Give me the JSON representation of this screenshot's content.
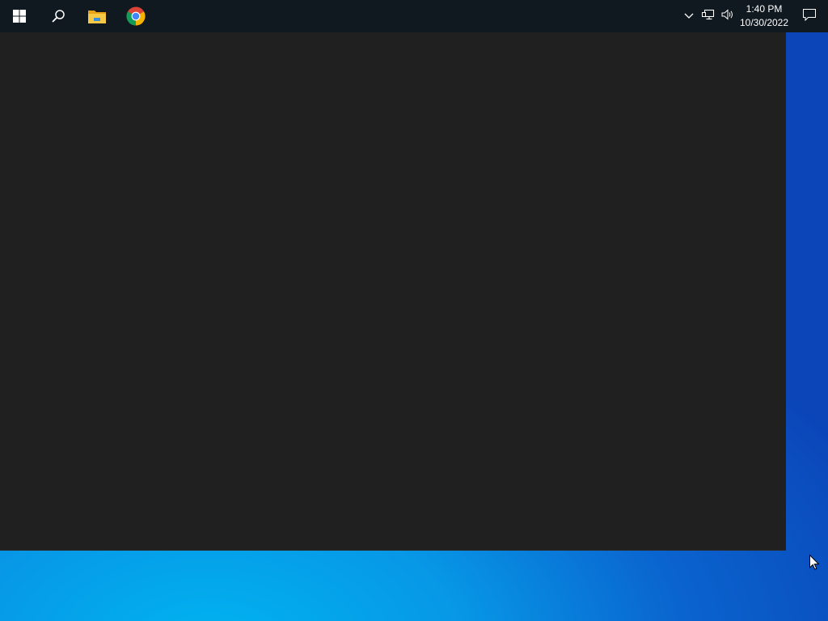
{
  "taskbar": {
    "icons": [
      {
        "name": "start-windows-icon",
        "color": "#ffffff"
      },
      {
        "name": "search-icon",
        "color": "#ffffff"
      },
      {
        "name": "file-explorer-icon",
        "color": "#f4c542"
      },
      {
        "name": "chrome-icon",
        "colors": [
          "#db4437",
          "#0f9d58",
          "#f4b400",
          "#4285f4"
        ]
      }
    ],
    "tray": {
      "icons": [
        "chevron-up-icon",
        "network-icon",
        "volume-icon",
        "notification-icon"
      ],
      "time": "1:40 PM",
      "date": "10/30/2022"
    }
  },
  "window": {
    "background": "#202020"
  },
  "desktop": {
    "colors": [
      "#00b4f0",
      "#0a64cf",
      "#0b45b8"
    ]
  }
}
